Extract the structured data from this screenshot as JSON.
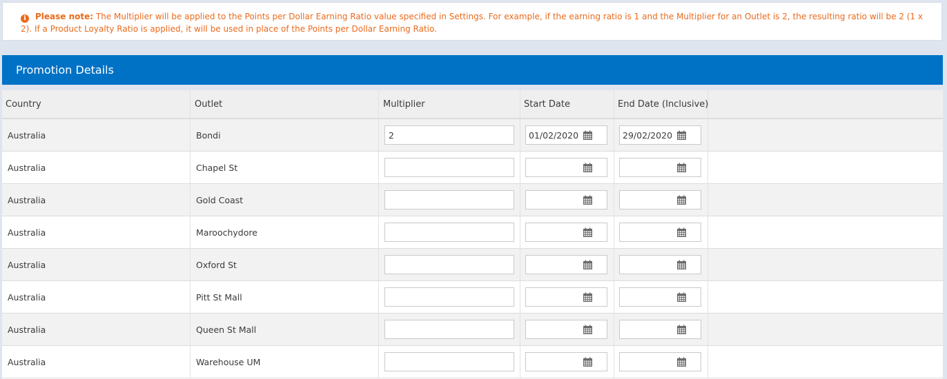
{
  "note": {
    "label": "Please note:",
    "text": " The Multiplier will be applied to the Points per Dollar Earning Ratio value specified in Settings. For example, if the earning ratio is 1 and the Multiplier for an Outlet is 2, the resulting ratio will be 2 (1 x 2). If a Product Loyalty Ratio is applied, it will be used in place of the Points per Dollar Earning Ratio.",
    "icon": "info-icon",
    "color": "#ea6a1c"
  },
  "header": {
    "title": "Promotion Details",
    "color": "#0072c6"
  },
  "table": {
    "columns": [
      "Country",
      "Outlet",
      "Multiplier",
      "Start Date",
      "End Date (Inclusive)"
    ],
    "rows": [
      {
        "country": "Australia",
        "outlet": "Bondi",
        "multiplier": "2",
        "start": "01/02/2020",
        "end": "29/02/2020"
      },
      {
        "country": "Australia",
        "outlet": "Chapel St",
        "multiplier": "",
        "start": "",
        "end": ""
      },
      {
        "country": "Australia",
        "outlet": "Gold Coast",
        "multiplier": "",
        "start": "",
        "end": ""
      },
      {
        "country": "Australia",
        "outlet": "Maroochydore",
        "multiplier": "",
        "start": "",
        "end": ""
      },
      {
        "country": "Australia",
        "outlet": "Oxford St",
        "multiplier": "",
        "start": "",
        "end": ""
      },
      {
        "country": "Australia",
        "outlet": "Pitt St Mall",
        "multiplier": "",
        "start": "",
        "end": ""
      },
      {
        "country": "Australia",
        "outlet": "Queen St Mall",
        "multiplier": "",
        "start": "",
        "end": ""
      },
      {
        "country": "Australia",
        "outlet": "Warehouse UM",
        "multiplier": "",
        "start": "",
        "end": ""
      }
    ]
  },
  "icons": {
    "date_picker": "calendar-icon"
  }
}
